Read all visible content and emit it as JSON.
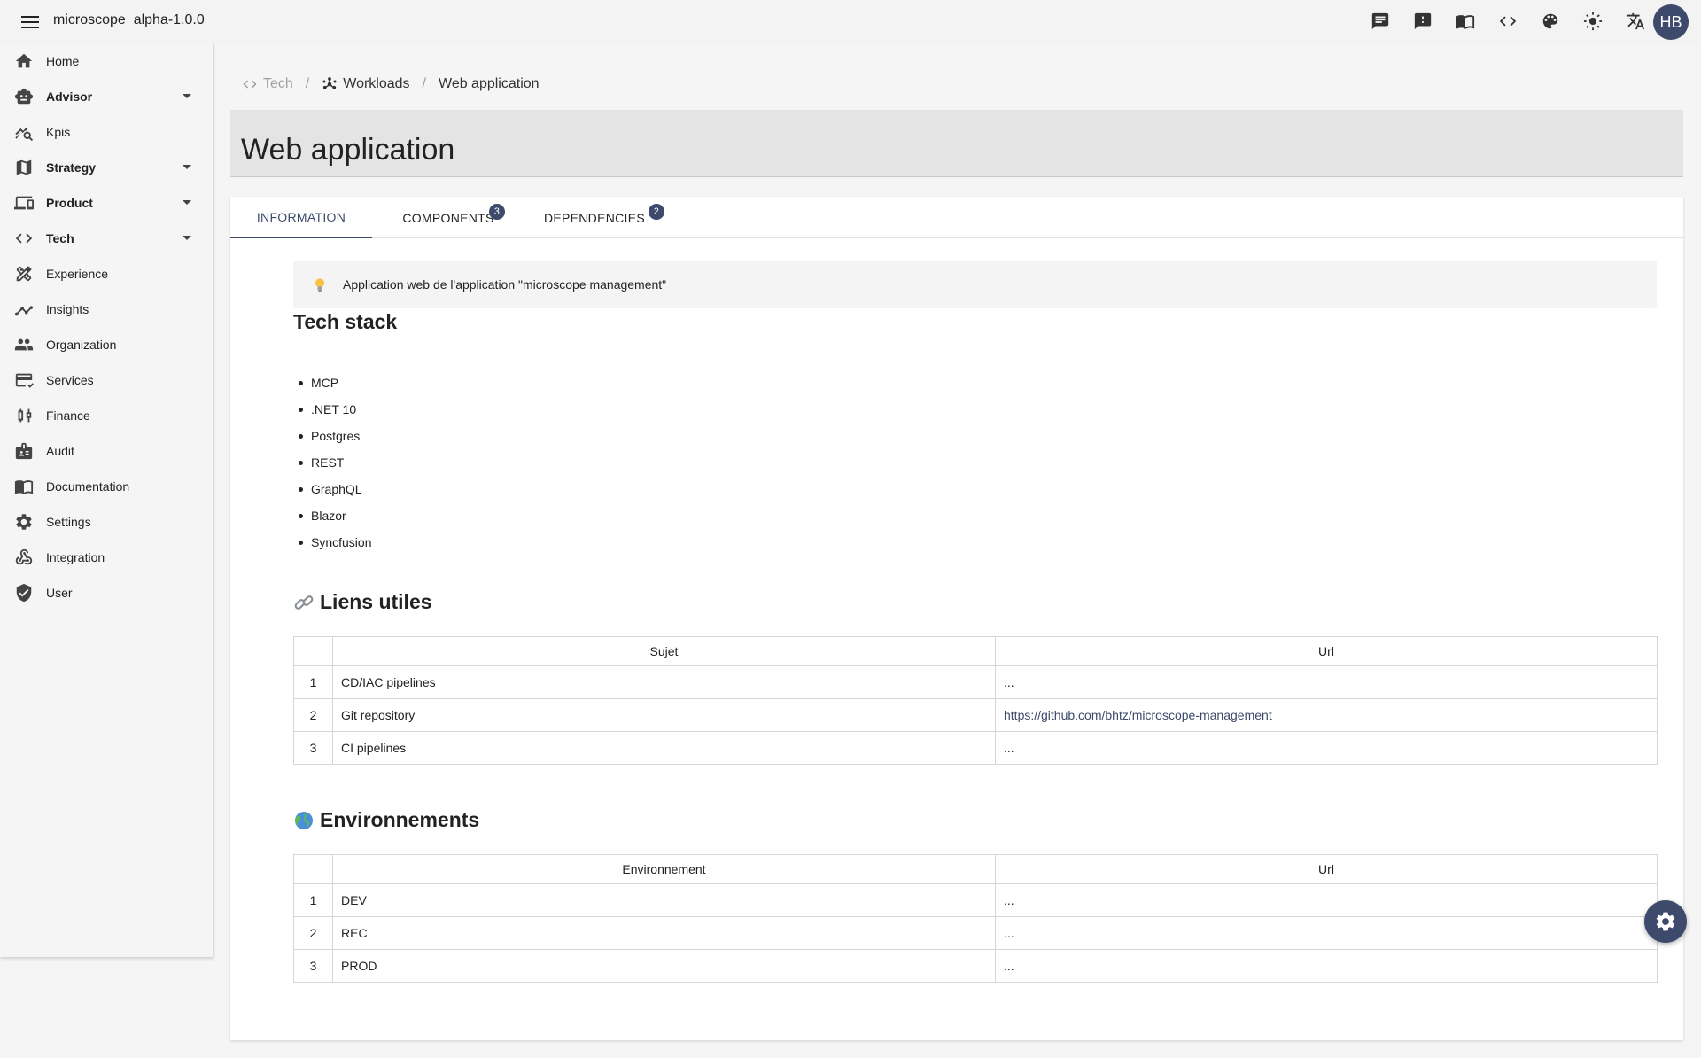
{
  "app": {
    "name": "microscope",
    "version": "alpha-1.0.0",
    "avatar_initials": "HB"
  },
  "topbar_icons": [
    "chat-icon",
    "feedback-icon",
    "book-icon",
    "code-icon",
    "palette-icon",
    "brightness-icon",
    "translate-icon"
  ],
  "sidebar": {
    "items": [
      {
        "label": "Home",
        "icon": "home-icon",
        "expandable": false,
        "bold": false
      },
      {
        "label": "Advisor",
        "icon": "robot-icon",
        "expandable": true,
        "bold": true
      },
      {
        "label": "Kpis",
        "icon": "kpi-icon",
        "expandable": false,
        "bold": false
      },
      {
        "label": "Strategy",
        "icon": "map-icon",
        "expandable": true,
        "bold": true
      },
      {
        "label": "Product",
        "icon": "devices-icon",
        "expandable": true,
        "bold": true
      },
      {
        "label": "Tech",
        "icon": "code-icon",
        "expandable": true,
        "bold": true
      },
      {
        "label": "Experience",
        "icon": "design-icon",
        "expandable": false,
        "bold": false
      },
      {
        "label": "Insights",
        "icon": "insights-icon",
        "expandable": false,
        "bold": false
      },
      {
        "label": "Organization",
        "icon": "people-icon",
        "expandable": false,
        "bold": false
      },
      {
        "label": "Services",
        "icon": "services-icon",
        "expandable": false,
        "bold": false
      },
      {
        "label": "Finance",
        "icon": "finance-icon",
        "expandable": false,
        "bold": false
      },
      {
        "label": "Audit",
        "icon": "audit-icon",
        "expandable": false,
        "bold": false
      },
      {
        "label": "Documentation",
        "icon": "documentation-icon",
        "expandable": false,
        "bold": false
      },
      {
        "label": "Settings",
        "icon": "settings-icon",
        "expandable": false,
        "bold": false
      },
      {
        "label": "Integration",
        "icon": "webhook-icon",
        "expandable": false,
        "bold": false
      },
      {
        "label": "User",
        "icon": "shield-icon",
        "expandable": false,
        "bold": false
      }
    ]
  },
  "breadcrumb": {
    "tech": "Tech",
    "workloads": "Workloads",
    "current": "Web application"
  },
  "page": {
    "title": "Web application"
  },
  "tabs": [
    {
      "label": "INFORMATION",
      "active": true,
      "badge": null
    },
    {
      "label": "COMPONENTS",
      "active": false,
      "badge": "3"
    },
    {
      "label": "DEPENDENCIES",
      "active": false,
      "badge": "2"
    }
  ],
  "callout": {
    "icon": "lightbulb-icon",
    "text": "Application web de l'application \"microscope management\""
  },
  "tech_stack": {
    "title": "Tech stack",
    "items": [
      "MCP",
      ".NET 10",
      "Postgres",
      "REST",
      "GraphQL",
      "Blazor",
      "Syncfusion"
    ]
  },
  "links": {
    "title": "Liens utiles",
    "headers": [
      "",
      "Sujet",
      "Url"
    ],
    "rows": [
      {
        "num": "1",
        "subject": "CD/IAC pipelines",
        "url": "...",
        "is_link": false
      },
      {
        "num": "2",
        "subject": "Git repository",
        "url": "https://github.com/bhtz/microscope-management",
        "is_link": true
      },
      {
        "num": "3",
        "subject": "CI pipelines",
        "url": "...",
        "is_link": false
      }
    ]
  },
  "environments": {
    "title": "Environnements",
    "headers": [
      "",
      "Environnement",
      "Url"
    ],
    "rows": [
      {
        "num": "1",
        "env": "DEV",
        "url": "..."
      },
      {
        "num": "2",
        "env": "REC",
        "url": "..."
      },
      {
        "num": "3",
        "env": "PROD",
        "url": "..."
      }
    ]
  },
  "colors": {
    "accent": "#3e4a6b",
    "title_bar_bg": "#e4e4e4",
    "sidebar_bg": "#f5f5f5"
  }
}
